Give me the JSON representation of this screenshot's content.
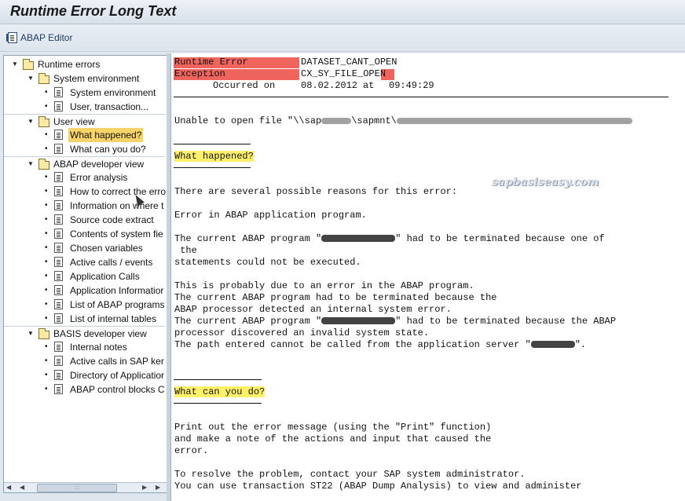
{
  "window": {
    "title": "Runtime Error Long Text"
  },
  "toolbar": {
    "abap_editor": "ABAP Editor"
  },
  "tree": {
    "root": "Runtime errors",
    "groups": [
      {
        "label": "System environment",
        "items": [
          "System environment",
          "User, transaction..."
        ]
      },
      {
        "label": "User view",
        "items": [
          "What happened?",
          "What can you do?"
        ]
      },
      {
        "label": "ABAP developer view",
        "items": [
          "Error analysis",
          "How to correct the erro",
          "Information on where t",
          "Source code extract",
          "Contents of system fie",
          "Chosen variables",
          "Active calls / events",
          "Application Calls",
          "Application Informatior",
          "List of ABAP programs",
          "List of internal tables"
        ]
      },
      {
        "label": "BASIS developer view",
        "items": [
          "Internal notes",
          "Active calls in SAP ker",
          "Directory of Applicatior",
          "ABAP control blocks C"
        ]
      }
    ],
    "selected": "What happened?"
  },
  "content": {
    "header": {
      "runtime_error_label": "Runtime Error",
      "runtime_error_value": "DATASET_CANT_OPEN",
      "exception_label": "Exception",
      "exception_value": "CX_SY_FILE_OPEN",
      "occurred_label": "Occurred on",
      "date": "08.02.2012",
      "at_label": "at",
      "time": "09:49:29"
    },
    "unable_line": "Unable to open file \"\\\\sap",
    "unable_mid": "\\sapmnt\\",
    "what_happened_heading": "What happened?",
    "wh_lines": [
      "There are several possible reasons for this error:",
      "Error in ABAP application program.",
      "The current ABAP program \"",
      "\" had to be terminated because one of",
      " the",
      "statements could not be executed.",
      "This is probably due to an error in the ABAP program.",
      "The current ABAP program had to be terminated because the",
      "ABAP processor detected an internal system error.",
      "The current ABAP program \"",
      "\" had to be terminated because the ABAP",
      "processor discovered an invalid system state.",
      "The path entered cannot be called from the application server \"",
      "\"."
    ],
    "what_can_you_do_heading": "What can you do?",
    "wcyd_lines": [
      "Print out the error message (using the \"Print\" function)",
      "and make a note of the actions and input that caused the",
      "error.",
      "To resolve the problem, contact your SAP system administrator.",
      "You can use transaction ST22 (ABAP Dump Analysis) to view and administer"
    ],
    "watermark": "sapbasiseasy.com"
  },
  "colors": {
    "red_cell": "#f0645e",
    "highlight": "#fff06a",
    "selection": "#f7d36a"
  }
}
